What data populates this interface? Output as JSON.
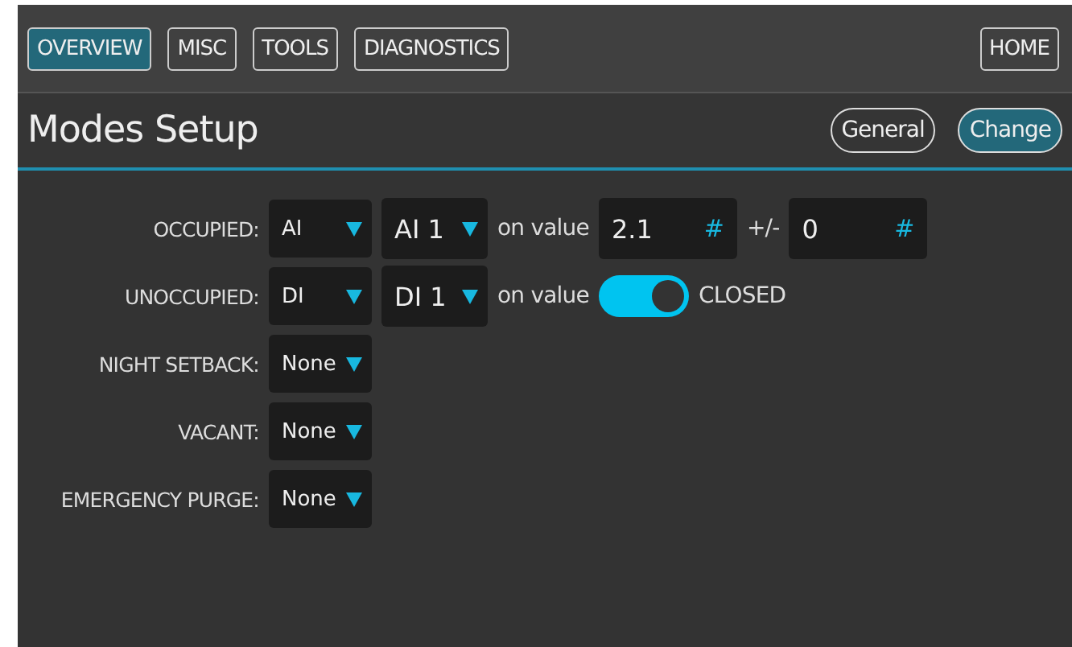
{
  "nav": {
    "tabs": [
      {
        "label": "OVERVIEW",
        "selected": true
      },
      {
        "label": "MISC",
        "selected": false
      },
      {
        "label": "TOOLS",
        "selected": false
      },
      {
        "label": "DIAGNOSTICS",
        "selected": false
      }
    ],
    "home": {
      "label": "HOME",
      "selected": false
    }
  },
  "header": {
    "title": "Modes Setup",
    "buttons": [
      {
        "label": "General",
        "selected": false
      },
      {
        "label": "Change",
        "selected": true
      }
    ]
  },
  "rows": [
    {
      "label": "OCCUPIED:",
      "controls": [
        {
          "kind": "select",
          "value": "AI"
        },
        {
          "kind": "channel",
          "value": "AI 1"
        },
        {
          "kind": "text",
          "text": "on value"
        },
        {
          "kind": "number",
          "value": "2.1",
          "unit": "#"
        },
        {
          "kind": "text",
          "text": "+/-"
        },
        {
          "kind": "number",
          "value": "0",
          "unit": "#"
        }
      ]
    },
    {
      "label": "UNOCCUPIED:",
      "controls": [
        {
          "kind": "select",
          "value": "DI"
        },
        {
          "kind": "channel",
          "value": "DI 1"
        },
        {
          "kind": "text",
          "text": "on value"
        },
        {
          "kind": "toggle",
          "on": true,
          "text": "CLOSED"
        }
      ]
    },
    {
      "label": "NIGHT SETBACK:",
      "controls": [
        {
          "kind": "select",
          "value": "None"
        }
      ]
    },
    {
      "label": "VACANT:",
      "controls": [
        {
          "kind": "select",
          "value": "None"
        }
      ]
    },
    {
      "label": "EMERGENCY PURGE:",
      "controls": [
        {
          "kind": "select",
          "value": "None"
        }
      ]
    }
  ]
}
